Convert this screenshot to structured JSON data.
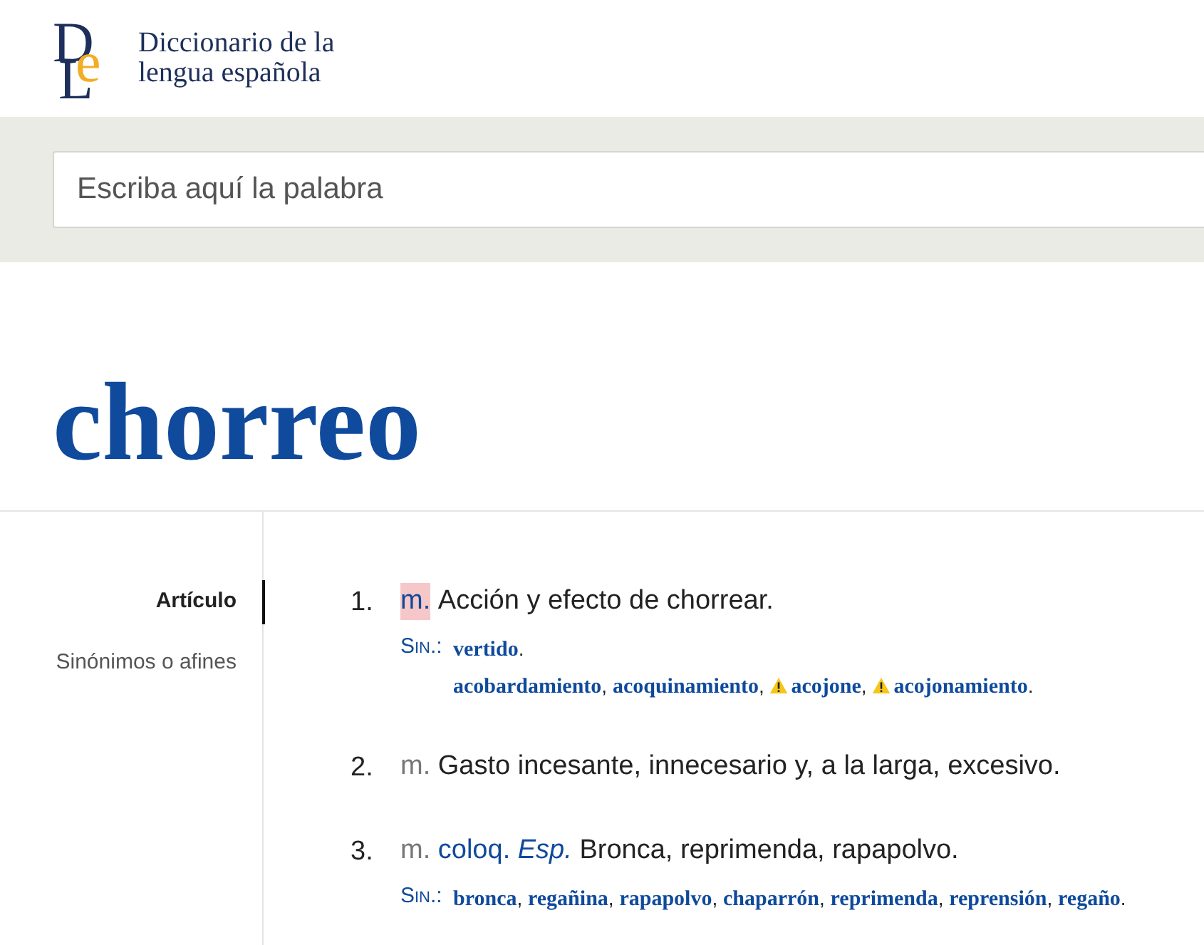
{
  "logo": {
    "letters": [
      "D",
      "e",
      "L"
    ],
    "title_lines": [
      "Diccionario de la",
      "lengua española"
    ]
  },
  "search": {
    "placeholder": "Escriba aquí la palabra"
  },
  "entry": {
    "headword": "chorreo"
  },
  "sidebar": {
    "items": [
      {
        "label": "Artículo",
        "selected": true
      },
      {
        "label": "Sinónimos o afines",
        "selected": false
      }
    ]
  },
  "definitions": [
    {
      "number": "1.",
      "abbreviations": [
        {
          "text": "m.",
          "kind": "grammar",
          "highlighted": true
        }
      ],
      "text": "Acción y efecto de chorrear.",
      "synonyms": {
        "label": "Sin.:",
        "groups": [
          [
            {
              "word": "vertido",
              "warning": false,
              "punct": "."
            }
          ],
          [
            {
              "word": "acobardamiento",
              "warning": false,
              "punct": ","
            },
            {
              "word": "acoquinamiento",
              "warning": false,
              "punct": ","
            },
            {
              "word": "acojone",
              "warning": true,
              "punct": ","
            },
            {
              "word": "acojonamiento",
              "warning": true,
              "punct": "."
            }
          ]
        ]
      }
    },
    {
      "number": "2.",
      "abbreviations": [
        {
          "text": "m.",
          "kind": "grammar",
          "highlighted": false
        }
      ],
      "text": "Gasto incesante, innecesario y, a la larga, excesivo."
    },
    {
      "number": "3.",
      "abbreviations": [
        {
          "text": "m.",
          "kind": "grammar",
          "highlighted": false
        },
        {
          "text": "coloq.",
          "kind": "usage",
          "highlighted": false
        },
        {
          "text": "Esp.",
          "kind": "region",
          "highlighted": false
        }
      ],
      "text": "Bronca, reprimenda, rapapolvo.",
      "synonyms": {
        "label": "Sin.:",
        "groups": [
          [
            {
              "word": "bronca",
              "warning": false,
              "punct": ","
            },
            {
              "word": "regañina",
              "warning": false,
              "punct": ","
            },
            {
              "word": "rapapolvo",
              "warning": false,
              "punct": ","
            },
            {
              "word": "chaparrón",
              "warning": false,
              "punct": ","
            },
            {
              "word": "reprimenda",
              "warning": false,
              "punct": ","
            },
            {
              "word": "reprensión",
              "warning": false,
              "punct": ","
            },
            {
              "word": "regaño",
              "warning": false,
              "punct": "."
            }
          ]
        ]
      }
    }
  ]
}
